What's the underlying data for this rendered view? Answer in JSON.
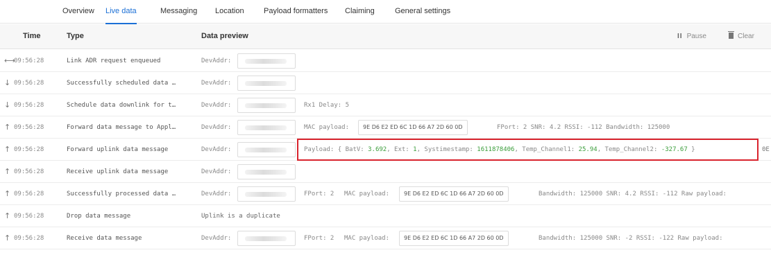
{
  "tabs": [
    {
      "label": "Overview"
    },
    {
      "label": "Live data"
    },
    {
      "label": "Messaging"
    },
    {
      "label": "Location"
    },
    {
      "label": "Payload formatters"
    },
    {
      "label": "Claiming"
    },
    {
      "label": "General settings"
    }
  ],
  "table": {
    "headers": {
      "time": "Time",
      "type": "Type",
      "preview": "Data preview"
    },
    "pause_label": "Pause",
    "clear_label": "Clear"
  },
  "rows": [
    {
      "arrow": "⟷",
      "time": "09:56:28",
      "type": "Link ADR request enqueued",
      "devaddr_label": "DevAddr:"
    },
    {
      "arrow": "↓",
      "time": "09:56:28",
      "type": "Successfully scheduled data …",
      "devaddr_label": "DevAddr:"
    },
    {
      "arrow": "↓",
      "time": "09:56:28",
      "type": "Schedule data downlink for t…",
      "devaddr_label": "DevAddr:",
      "rx1": "Rx1 Delay: 5"
    },
    {
      "arrow": "↑",
      "time": "09:56:28",
      "type": "Forward data message to Appl…",
      "devaddr_label": "DevAddr:",
      "mac_label": "MAC payload:",
      "mac_value": "9E D6 E2 ED 6C 1D 66 A7 2D 60 0D",
      "details": "FPort: 2  SNR: 4.2  RSSI: -112  Bandwidth: 125000"
    },
    {
      "arrow": "↑",
      "time": "09:56:28",
      "type": "Forward uplink data message",
      "devaddr_label": "DevAddr:",
      "payload": {
        "prefix": "Payload: { BatV:",
        "batv": "3.692",
        "ext_label": ", Ext:",
        "ext": "1",
        "sys_label": ", Systimestamp:",
        "sys": "1611878406",
        "t1_label": ", Temp_Channel1:",
        "t1": "25.94",
        "t2_label": ", Temp_Channel2:",
        "t2": "-327.67",
        "suffix": " }"
      },
      "tail": "0E"
    },
    {
      "arrow": "↑",
      "time": "09:56:28",
      "type": "Receive uplink data message",
      "devaddr_label": "DevAddr:"
    },
    {
      "arrow": "↑",
      "time": "09:56:28",
      "type": "Successfully processed data …",
      "devaddr_label": "DevAddr:",
      "fport": "FPort: 2",
      "mac_label": "MAC payload:",
      "mac_value": "9E D6 E2 ED 6C 1D 66 A7 2D 60 0D",
      "details": "Bandwidth: 125000  SNR: 4.2  RSSI: -112  Raw payload:"
    },
    {
      "arrow": "↑",
      "time": "09:56:28",
      "type": "Drop data message",
      "preview_text": "Uplink is a duplicate"
    },
    {
      "arrow": "↑",
      "time": "09:56:28",
      "type": "Receive data message",
      "devaddr_label": "DevAddr:",
      "fport": "FPort: 2",
      "mac_label": "MAC payload:",
      "mac_value": "9E D6 E2 ED 6C 1D 66 A7 2D 60 0D",
      "details": "Bandwidth: 125000  SNR: -2  RSSI: -122  Raw payload:"
    }
  ]
}
